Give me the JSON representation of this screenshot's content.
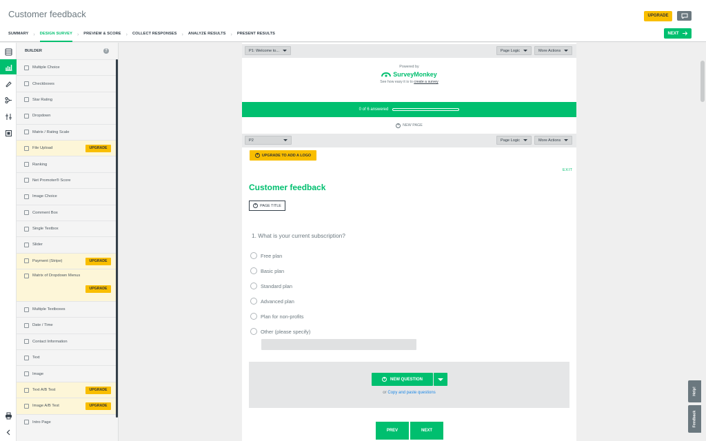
{
  "app": {
    "title": "Customer feedback",
    "upgrade_label": "UPGRADE"
  },
  "nav": {
    "tabs": [
      "SUMMARY",
      "DESIGN SURVEY",
      "PREVIEW & SCORE",
      "COLLECT RESPONSES",
      "ANALYZE RESULTS",
      "PRESENT RESULTS"
    ],
    "active_tab": "DESIGN SURVEY",
    "next_label": "NEXT"
  },
  "rail": {
    "icons": [
      "survey-icon",
      "builder-icon",
      "design-icon",
      "logic-icon",
      "options-icon",
      "library-icon",
      "print-icon",
      "collapse-icon"
    ]
  },
  "builder": {
    "title": "BUILDER",
    "upgrade_label": "UPGRADE",
    "items": [
      {
        "label": "Multiple Choice",
        "upgrade": false
      },
      {
        "label": "Checkboxes",
        "upgrade": false
      },
      {
        "label": "Star Rating",
        "upgrade": false
      },
      {
        "label": "Dropdown",
        "upgrade": false
      },
      {
        "label": "Matrix / Rating Scale",
        "upgrade": false
      },
      {
        "label": "File Upload",
        "upgrade": true
      },
      {
        "label": "Ranking",
        "upgrade": false
      },
      {
        "label": "Net Promoter® Score",
        "upgrade": false
      },
      {
        "label": "Image Choice",
        "upgrade": false
      },
      {
        "label": "Comment Box",
        "upgrade": false
      },
      {
        "label": "Single Textbox",
        "upgrade": false
      },
      {
        "label": "Slider",
        "upgrade": false
      },
      {
        "label": "Payment (Stripe)",
        "upgrade": true
      },
      {
        "label": "Matrix of Dropdown Menus",
        "upgrade": true
      },
      {
        "label": "Multiple Textboxes",
        "upgrade": false
      },
      {
        "label": "Date / Time",
        "upgrade": false
      },
      {
        "label": "Contact Information",
        "upgrade": false
      },
      {
        "label": "Text",
        "upgrade": false
      },
      {
        "label": "Image",
        "upgrade": false
      },
      {
        "label": "Text A/B Test",
        "upgrade": true
      },
      {
        "label": "Image A/B Test",
        "upgrade": true
      },
      {
        "label": "Intro Page",
        "upgrade": false
      }
    ]
  },
  "page1": {
    "selector": "P1: Welcome to...",
    "page_logic": "Page Logic",
    "more_actions": "More Actions",
    "powered_by": "Powered by",
    "brand": "SurveyMonkey",
    "see_how": "See how easy it is to",
    "create_link": "create a survey",
    "progress_text": "0 of 6 answered",
    "progress_fraction": 0
  },
  "new_page_label": "NEW PAGE",
  "page2": {
    "selector": "P2",
    "page_logic": "Page Logic",
    "more_actions": "More Actions",
    "upgrade_logo": "UPGRADE TO ADD A LOGO",
    "exit": "EXIT",
    "title": "Customer feedback",
    "page_title_btn": "PAGE TITLE",
    "question": "1. What is your current subscription?",
    "options": [
      "Free plan",
      "Basic plan",
      "Standard plan",
      "Advanced plan",
      "Plan for non-profits",
      "Other (please specify)"
    ],
    "new_question": "NEW QUESTION",
    "or": "or",
    "copy_paste": "Copy and paste questions",
    "prev": "PREV",
    "next": "NEXT"
  },
  "side_tabs": {
    "help": "Help!",
    "feedback": "Feedback"
  },
  "colors": {
    "brand_green": "#00bf6f",
    "upgrade_yellow": "#f9be00",
    "text_dark": "#333e48",
    "text_muted": "#6b787f"
  }
}
